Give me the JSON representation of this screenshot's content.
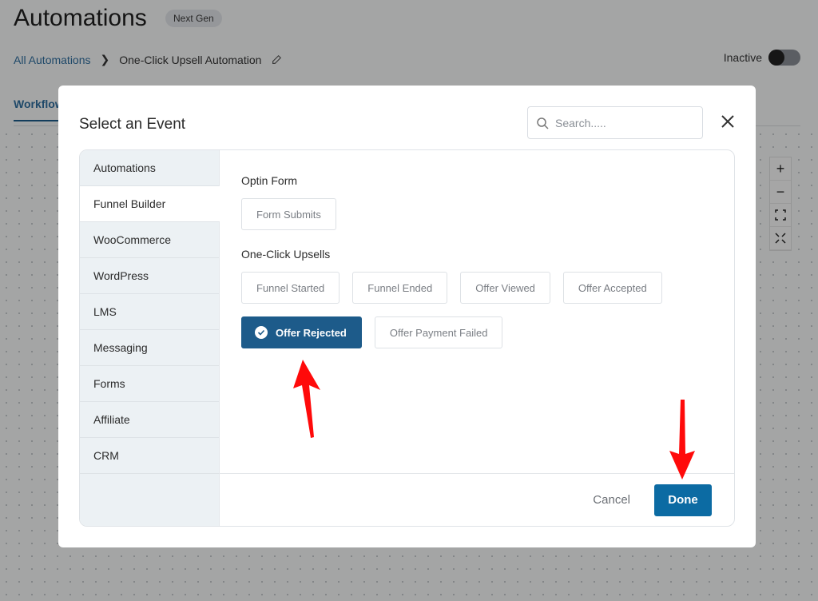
{
  "page": {
    "title": "Automations",
    "badge": "Next Gen",
    "breadcrumb": {
      "parent": "All Automations",
      "current": "One-Click Upsell Automation"
    },
    "status_label": "Inactive",
    "status_active": false,
    "tab": "Workflow",
    "zoom_controls": [
      "+",
      "−"
    ]
  },
  "modal": {
    "title": "Select an Event",
    "search_placeholder": "Search.....",
    "sidebar": [
      {
        "label": "Automations"
      },
      {
        "label": "Funnel Builder",
        "active": true
      },
      {
        "label": "WooCommerce"
      },
      {
        "label": "WordPress"
      },
      {
        "label": "LMS"
      },
      {
        "label": "Messaging"
      },
      {
        "label": "Forms"
      },
      {
        "label": "Affiliate"
      },
      {
        "label": "CRM"
      }
    ],
    "sections": [
      {
        "title": "Optin Form",
        "events": [
          "Form Submits"
        ]
      },
      {
        "title": "One-Click Upsells",
        "events": [
          "Funnel Started",
          "Funnel Ended",
          "Offer Viewed",
          "Offer Accepted",
          "Offer Rejected",
          "Offer Payment Failed"
        ]
      }
    ],
    "selected_event": "Offer Rejected",
    "footer": {
      "cancel": "Cancel",
      "done": "Done"
    }
  },
  "colors": {
    "primary": "#0c6ba3",
    "selected": "#1d5b8a",
    "annotation": "#ff0000"
  }
}
